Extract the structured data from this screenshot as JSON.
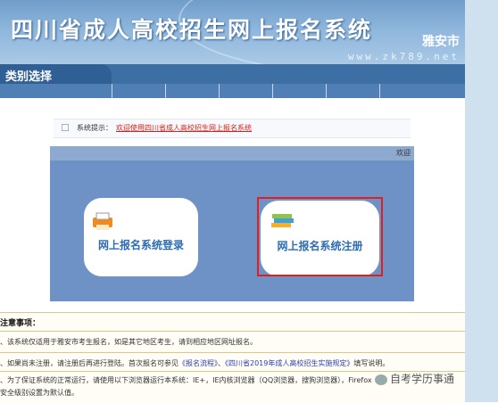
{
  "header": {
    "title": "四川省成人高校招生网上报名系统",
    "city": "雅安市",
    "url": "www.zk789.net"
  },
  "category": {
    "tab_label": "类别选择"
  },
  "notice": {
    "label": "系统提示：",
    "message": "欢迎使用四川省成人高校招生网上报名系统"
  },
  "welcome_text": "欢迎",
  "cards": {
    "login": "网上报名系统登录",
    "register": "网上报名系统注册"
  },
  "notes": {
    "heading": "注意事项：",
    "line1": "、该系统仅适用于雅安市考生报名，如是其它地区考生，请到相应地区网址报名。",
    "line2_pre": "、如果尚未注册，请注册后再进行登陆。首次报名可参见",
    "line2_link1": "《报名流程》",
    "line2_mid": "、",
    "line2_link2": "《四川省2019年成人高校招生实施规定》",
    "line2_post": "填写说明。",
    "line3": "、为了保证系统的正常运行，请使用以下浏览器运行本系统：IE+，IE内核浏览器（QQ浏览器，搜狗浏览器），Firefox",
    "line4": "安全级别设置为默认值。"
  },
  "watermark": "自考学历事通"
}
